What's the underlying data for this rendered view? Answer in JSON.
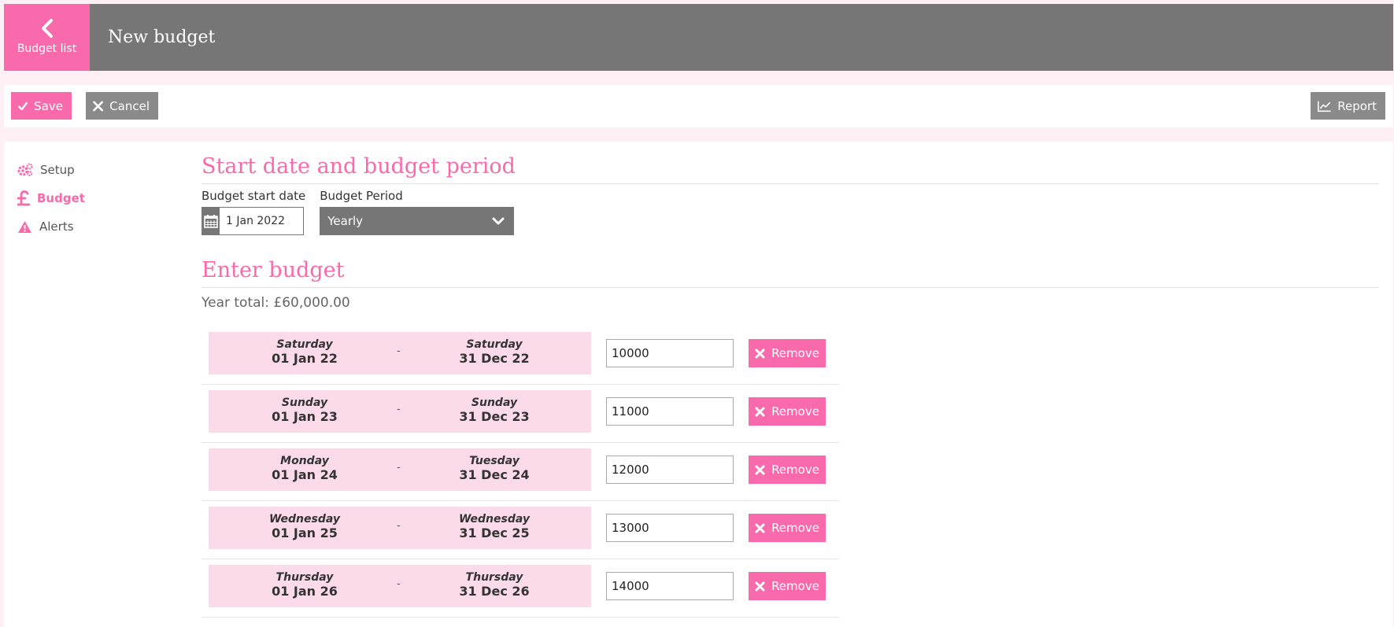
{
  "header": {
    "back_label": "Budget list",
    "title": "New budget"
  },
  "toolbar": {
    "save_label": "Save",
    "cancel_label": "Cancel",
    "report_label": "Report"
  },
  "sidebar": {
    "items": [
      {
        "label": "Setup",
        "icon": "gears-icon"
      },
      {
        "label": "Budget",
        "icon": "pound-icon",
        "active": true
      },
      {
        "label": "Alerts",
        "icon": "warning-icon"
      }
    ]
  },
  "start_section": {
    "title": "Start date and budget period",
    "start_date_label": "Budget start date",
    "start_date_value": "1 Jan 2022",
    "period_label": "Budget Period",
    "period_value": "Yearly"
  },
  "budget_section": {
    "title": "Enter budget",
    "year_total": "Year total: £60,000.00",
    "separator": "-",
    "remove_label": "Remove",
    "periods": [
      {
        "start_day": "Saturday",
        "start_date": "01 Jan 22",
        "end_day": "Saturday",
        "end_date": "31 Dec 22",
        "amount": "10000"
      },
      {
        "start_day": "Sunday",
        "start_date": "01 Jan 23",
        "end_day": "Sunday",
        "end_date": "31 Dec 23",
        "amount": "11000"
      },
      {
        "start_day": "Monday",
        "start_date": "01 Jan 24",
        "end_day": "Tuesday",
        "end_date": "31 Dec 24",
        "amount": "12000"
      },
      {
        "start_day": "Wednesday",
        "start_date": "01 Jan 25",
        "end_day": "Wednesday",
        "end_date": "31 Dec 25",
        "amount": "13000"
      },
      {
        "start_day": "Thursday",
        "start_date": "01 Jan 26",
        "end_day": "Thursday",
        "end_date": "31 Dec 26",
        "amount": "14000"
      }
    ]
  },
  "colors": {
    "accent": "#f86aab",
    "header_gray": "#767676",
    "button_gray": "#8a8a8a",
    "period_bg": "#fbdbe9",
    "page_bg": "#fff0f6"
  }
}
